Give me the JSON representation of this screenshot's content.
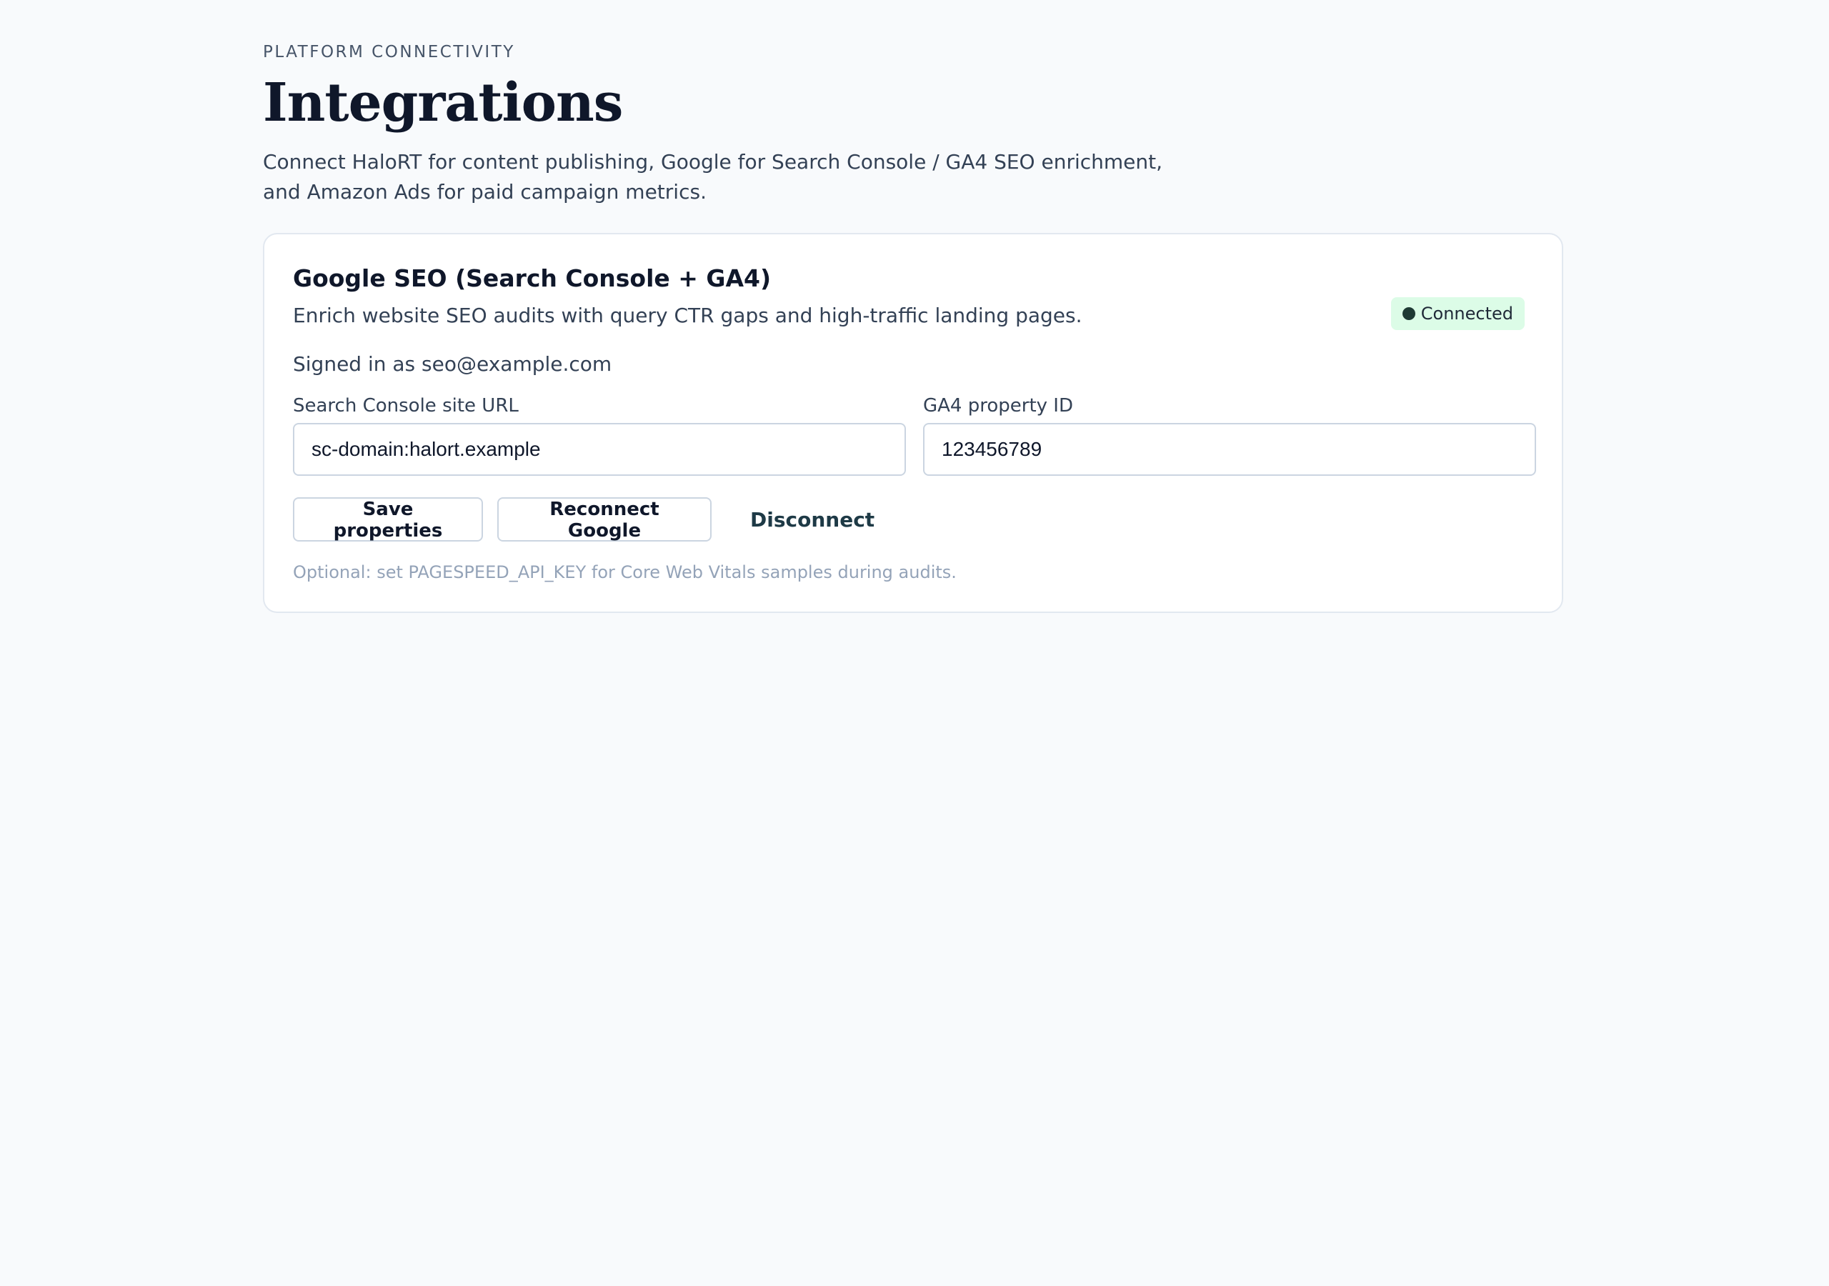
{
  "header": {
    "eyebrow": "PLATFORM CONNECTIVITY",
    "title": "Integrations",
    "description": "Connect HaloRT for content publishing, Google for Search Console / GA4 SEO enrichment, and Amazon Ads for paid campaign metrics."
  },
  "card": {
    "title": "Google SEO (Search Console + GA4)",
    "description": "Enrich website SEO audits with query CTR gaps and high-traffic landing pages.",
    "status": {
      "label": "Connected",
      "color": "#dcfce7",
      "dot_color": "#1e3a34"
    },
    "signed_in": "Signed in as seo@example.com",
    "fields": {
      "site_url": {
        "label": "Search Console site URL",
        "value": "sc-domain:halort.example"
      },
      "ga4_property": {
        "label": "GA4 property ID",
        "value": "123456789"
      }
    },
    "actions": {
      "save": "Save properties",
      "reconnect": "Reconnect Google",
      "disconnect": "Disconnect"
    },
    "hint": "Optional: set PAGESPEED_API_KEY for Core Web Vitals samples during audits."
  }
}
